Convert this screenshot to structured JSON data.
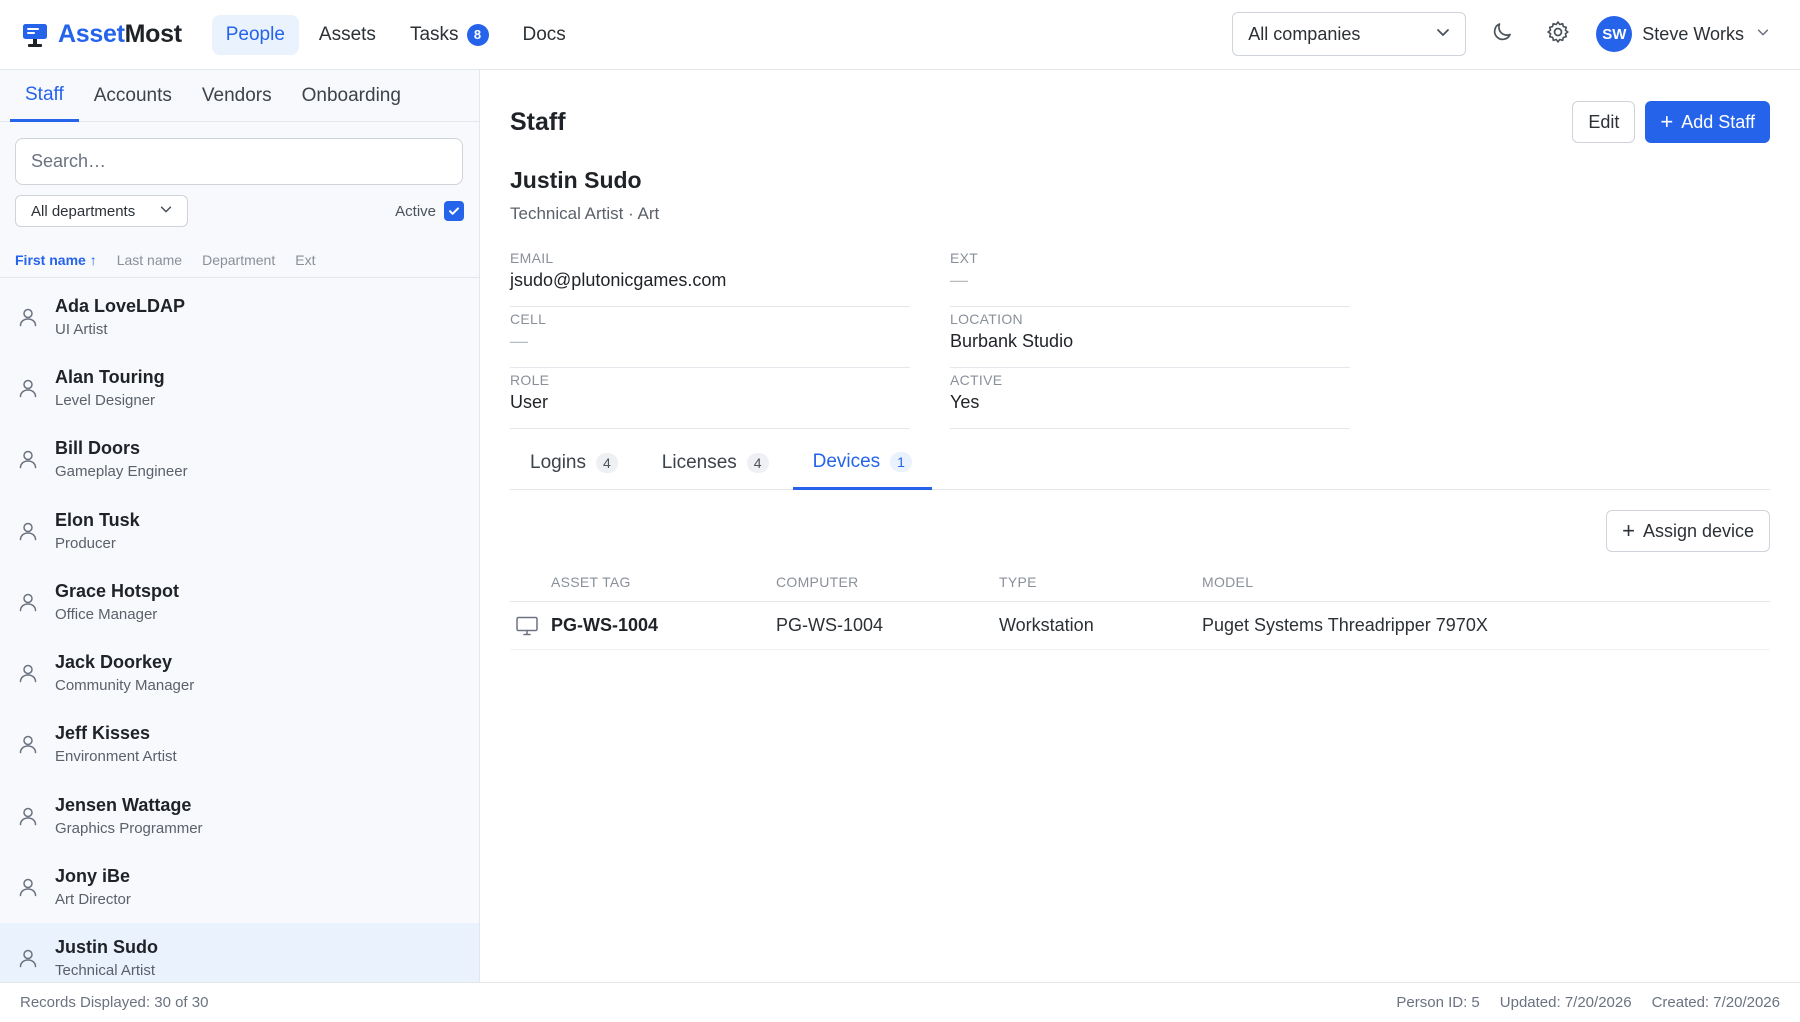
{
  "app": {
    "brand_first": "Asset",
    "brand_second": "Most",
    "nav": [
      {
        "label": "People",
        "active": true
      },
      {
        "label": "Assets"
      },
      {
        "label": "Tasks",
        "badge": "8"
      },
      {
        "label": "Docs"
      }
    ],
    "company_select": "All companies",
    "user": {
      "initials": "SW",
      "name": "Steve Works"
    },
    "accent_color": "#2563eb"
  },
  "sidebar": {
    "tabs": [
      "Staff",
      "Accounts",
      "Vendors",
      "Onboarding"
    ],
    "search_placeholder": "Search…",
    "department_filter": "All departments",
    "active_label": "Active",
    "active_checked": true,
    "sort_columns": [
      "First name ↑",
      "Last name",
      "Department",
      "Ext"
    ],
    "people": [
      {
        "name": "Ada LoveLDAP",
        "title": "UI Artist"
      },
      {
        "name": "Alan Touring",
        "title": "Level Designer"
      },
      {
        "name": "Bill Doors",
        "title": "Gameplay Engineer"
      },
      {
        "name": "Elon Tusk",
        "title": "Producer"
      },
      {
        "name": "Grace Hotspot",
        "title": "Office Manager"
      },
      {
        "name": "Jack Doorkey",
        "title": "Community Manager"
      },
      {
        "name": "Jeff Kisses",
        "title": "Environment Artist"
      },
      {
        "name": "Jensen Wattage",
        "title": "Graphics Programmer"
      },
      {
        "name": "Jony iBe",
        "title": "Art Director"
      },
      {
        "name": "Justin Sudo",
        "title": "Technical Artist",
        "selected": true
      }
    ]
  },
  "main": {
    "title": "Staff",
    "edit_label": "Edit",
    "add_label": "Add Staff",
    "person": {
      "name": "Justin Sudo",
      "subtitle": "Technical Artist · Art"
    },
    "fields": [
      {
        "label": "EMAIL",
        "value": "jsudo@plutonicgames.com"
      },
      {
        "label": "EXT",
        "value": "—",
        "empty": true
      },
      {
        "label": "CELL",
        "value": "—",
        "empty": true
      },
      {
        "label": "LOCATION",
        "value": "Burbank Studio"
      },
      {
        "label": "ROLE",
        "value": "User"
      },
      {
        "label": "ACTIVE",
        "value": "Yes"
      }
    ],
    "tabs": [
      {
        "label": "Logins",
        "count": "4"
      },
      {
        "label": "Licenses",
        "count": "4"
      },
      {
        "label": "Devices",
        "count": "1",
        "active": true
      }
    ],
    "assign_label": "Assign device",
    "table": {
      "headers": [
        "ASSET TAG",
        "COMPUTER",
        "TYPE",
        "MODEL"
      ],
      "rows": [
        {
          "asset_tag": "PG-WS-1004",
          "computer": "PG-WS-1004",
          "type": "Workstation",
          "model": "Puget Systems Threadripper 7970X"
        }
      ]
    }
  },
  "footer": {
    "records": "Records Displayed: 30 of 30",
    "person_id": "Person ID: 5",
    "updated": "Updated: 7/20/2026",
    "created": "Created: 7/20/2026"
  }
}
